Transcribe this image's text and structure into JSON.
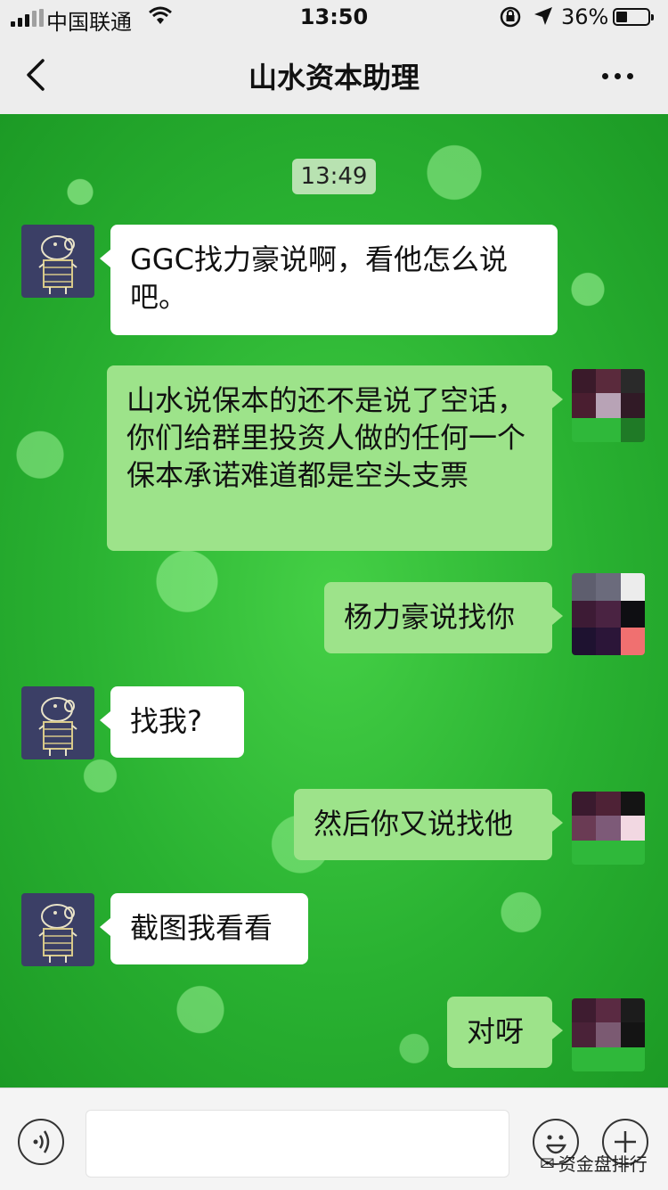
{
  "status_bar": {
    "carrier": "中国联通",
    "time": "13:50",
    "battery_percent": "36%",
    "battery_level": 0.36
  },
  "nav": {
    "title": "山水资本助理"
  },
  "chat": {
    "timestamp": "13:49",
    "messages": [
      {
        "side": "in",
        "text": "GGC找力豪说啊，看他怎么说吧。"
      },
      {
        "side": "out",
        "text": "山水说保本的还不是说了空话，你们给群里投资人做的任何一个保本承诺难道都是空头支票"
      },
      {
        "side": "out",
        "text": "杨力豪说找你"
      },
      {
        "side": "in",
        "text": "找我?"
      },
      {
        "side": "out",
        "text": "然后你又说找他"
      },
      {
        "side": "in",
        "text": "截图我看看"
      },
      {
        "side": "out",
        "text": "对呀"
      }
    ]
  },
  "watermark": {
    "text": "资金盘排行"
  },
  "colors": {
    "chat_bg": "#2fb83a",
    "incoming_bubble": "#ffffff",
    "outgoing_bubble": "#9de38a",
    "bar_bg": "#ededed"
  }
}
